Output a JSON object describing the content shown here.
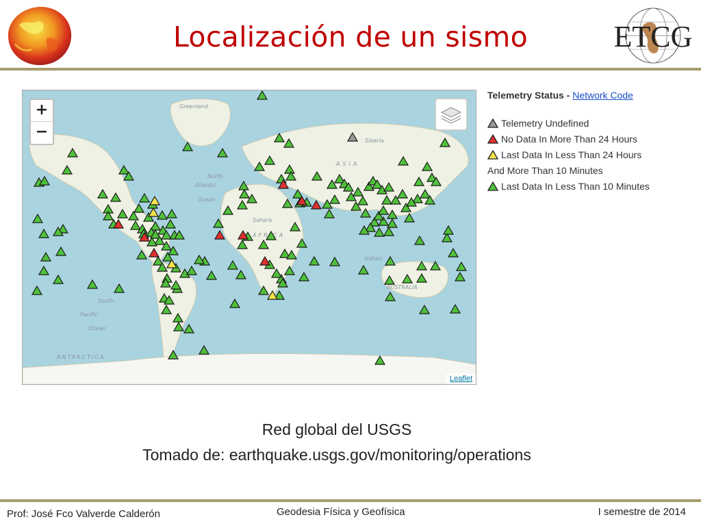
{
  "slide": {
    "title": "Localización de un sismo",
    "caption_line1": "Red global del USGS",
    "caption_line2": "Tomado de: earthquake.usgs.gov/monitoring/operations"
  },
  "logo": {
    "text": "ETCG"
  },
  "footer": {
    "author": "Prof: José Fco Valverde Calderón",
    "course": "Geodesia Física y Geofísica",
    "semester": "I semestre de 2014"
  },
  "map": {
    "zoom_in_label": "+",
    "zoom_out_label": "−",
    "attribution": "Leaflet",
    "labels": {
      "greenland": "Greenland",
      "siberia": "Siberia",
      "asia": "ASIA",
      "north": "North",
      "atlantic": "Atlantic",
      "ocean": "Ocean",
      "sahara": "Sahara",
      "africa": "AFRICA",
      "australia": "AUSTRALIA",
      "south": "South",
      "pacific": "Pacific",
      "indian": "Indian",
      "antarctica": "ANTARCTICA"
    },
    "stations": {
      "green": [
        [
          350,
          8
        ],
        [
          241,
          83
        ],
        [
          292,
          92
        ],
        [
          375,
          70
        ],
        [
          389,
          78
        ],
        [
          617,
          77
        ],
        [
          73,
          92
        ],
        [
          65,
          117
        ],
        [
          24,
          135
        ],
        [
          148,
          117
        ],
        [
          155,
          126
        ],
        [
          117,
          152
        ],
        [
          136,
          157
        ],
        [
          178,
          158
        ],
        [
          125,
          174
        ],
        [
          170,
          173
        ],
        [
          190,
          167
        ],
        [
          146,
          181
        ],
        [
          125,
          184
        ],
        [
          162,
          184
        ],
        [
          184,
          186
        ],
        [
          204,
          183
        ],
        [
          133,
          196
        ],
        [
          218,
          181
        ],
        [
          165,
          198
        ],
        [
          194,
          199
        ],
        [
          175,
          203
        ],
        [
          216,
          196
        ],
        [
          222,
          212
        ],
        [
          205,
          205
        ],
        [
          188,
          208
        ],
        [
          177,
          210
        ],
        [
          194,
          211
        ],
        [
          210,
          212
        ],
        [
          229,
          212
        ],
        [
          200,
          220
        ],
        [
          189,
          222
        ],
        [
          210,
          228
        ],
        [
          220,
          235
        ],
        [
          174,
          241
        ],
        [
          212,
          244
        ],
        [
          198,
          250
        ],
        [
          204,
          259
        ],
        [
          224,
          260
        ],
        [
          211,
          275
        ],
        [
          237,
          268
        ],
        [
          209,
          282
        ],
        [
          226,
          290
        ],
        [
          207,
          304
        ],
        [
          210,
          321
        ],
        [
          227,
          333
        ],
        [
          243,
          349
        ],
        [
          266,
          250
        ],
        [
          247,
          264
        ],
        [
          286,
          195
        ],
        [
          300,
          176
        ],
        [
          321,
          168
        ],
        [
          324,
          152
        ],
        [
          335,
          159
        ],
        [
          323,
          140
        ],
        [
          346,
          112
        ],
        [
          361,
          103
        ],
        [
          378,
          130
        ],
        [
          390,
          116
        ],
        [
          392,
          126
        ],
        [
          387,
          166
        ],
        [
          405,
          165
        ],
        [
          402,
          152
        ],
        [
          415,
          164
        ],
        [
          430,
          126
        ],
        [
          445,
          167
        ],
        [
          448,
          181
        ],
        [
          452,
          138
        ],
        [
          463,
          130
        ],
        [
          470,
          137
        ],
        [
          476,
          142
        ],
        [
          456,
          160
        ],
        [
          480,
          156
        ],
        [
          490,
          149
        ],
        [
          497,
          162
        ],
        [
          506,
          141
        ],
        [
          512,
          133
        ],
        [
          518,
          138
        ],
        [
          525,
          146
        ],
        [
          532,
          161
        ],
        [
          540,
          182
        ],
        [
          535,
          142
        ],
        [
          545,
          161
        ],
        [
          555,
          152
        ],
        [
          560,
          172
        ],
        [
          565,
          187
        ],
        [
          577,
          159
        ],
        [
          568,
          164
        ],
        [
          579,
          134
        ],
        [
          588,
          152
        ],
        [
          595,
          161
        ],
        [
          598,
          128
        ],
        [
          604,
          134
        ],
        [
          591,
          112
        ],
        [
          556,
          104
        ],
        [
          487,
          170
        ],
        [
          501,
          180
        ],
        [
          514,
          193
        ],
        [
          508,
          201
        ],
        [
          499,
          205
        ],
        [
          521,
          208
        ],
        [
          527,
          192
        ],
        [
          535,
          207
        ],
        [
          520,
          184
        ],
        [
          527,
          176
        ],
        [
          540,
          195
        ],
        [
          329,
          214
        ],
        [
          321,
          226
        ],
        [
          352,
          226
        ],
        [
          363,
          213
        ],
        [
          398,
          200
        ],
        [
          408,
          224
        ],
        [
          383,
          239
        ],
        [
          393,
          241
        ],
        [
          426,
          250
        ],
        [
          456,
          251
        ],
        [
          498,
          263
        ],
        [
          537,
          250
        ],
        [
          583,
          257
        ],
        [
          603,
          257
        ],
        [
          629,
          238
        ],
        [
          620,
          216
        ],
        [
          622,
          205
        ],
        [
          641,
          258
        ],
        [
          639,
          273
        ],
        [
          583,
          275
        ],
        [
          562,
          276
        ],
        [
          536,
          278
        ],
        [
          580,
          220
        ],
        [
          537,
          302
        ],
        [
          587,
          321
        ],
        [
          632,
          320
        ],
        [
          411,
          273
        ],
        [
          378,
          276
        ],
        [
          371,
          268
        ],
        [
          361,
          255
        ],
        [
          390,
          264
        ],
        [
          352,
          293
        ],
        [
          380,
          282
        ],
        [
          375,
          300
        ],
        [
          310,
          312
        ],
        [
          319,
          270
        ],
        [
          307,
          256
        ],
        [
          276,
          271
        ],
        [
          258,
          248
        ],
        [
          224,
          285
        ],
        [
          214,
          307
        ],
        [
          228,
          346
        ],
        [
          265,
          380
        ],
        [
          32,
          133
        ],
        [
          22,
          188
        ],
        [
          31,
          210
        ],
        [
          34,
          244
        ],
        [
          56,
          236
        ],
        [
          59,
          203
        ],
        [
          52,
          207
        ],
        [
          52,
          277
        ],
        [
          21,
          293
        ],
        [
          31,
          264
        ],
        [
          102,
          284
        ],
        [
          141,
          290
        ],
        [
          220,
          387
        ],
        [
          522,
          395
        ]
      ],
      "red": [
        [
          381,
          138
        ],
        [
          408,
          162
        ],
        [
          429,
          168
        ],
        [
          354,
          250
        ],
        [
          140,
          196
        ],
        [
          178,
          215
        ],
        [
          192,
          238
        ],
        [
          322,
          212
        ],
        [
          288,
          212
        ]
      ],
      "yellow": [
        [
          193,
          162
        ],
        [
          365,
          300
        ],
        [
          218,
          254
        ],
        [
          191,
          179
        ]
      ],
      "gray": [
        [
          482,
          69
        ]
      ]
    }
  },
  "legend": {
    "heading": "Telemetry Status",
    "separator": " - ",
    "link": "Network Code",
    "items": {
      "undefined": "Telemetry Undefined",
      "no_data": "No Data In More Than 24 Hours",
      "last_24_line1": "Last Data In Less Than 24 Hours",
      "last_24_line2": "And More Than 10 Minutes",
      "last_10": "Last Data In Less Than 10 Minutes"
    },
    "colors": {
      "gray": "#9a9a9a",
      "red": "#e03030",
      "yellow": "#f2e34a",
      "green": "#4fc13a"
    }
  }
}
